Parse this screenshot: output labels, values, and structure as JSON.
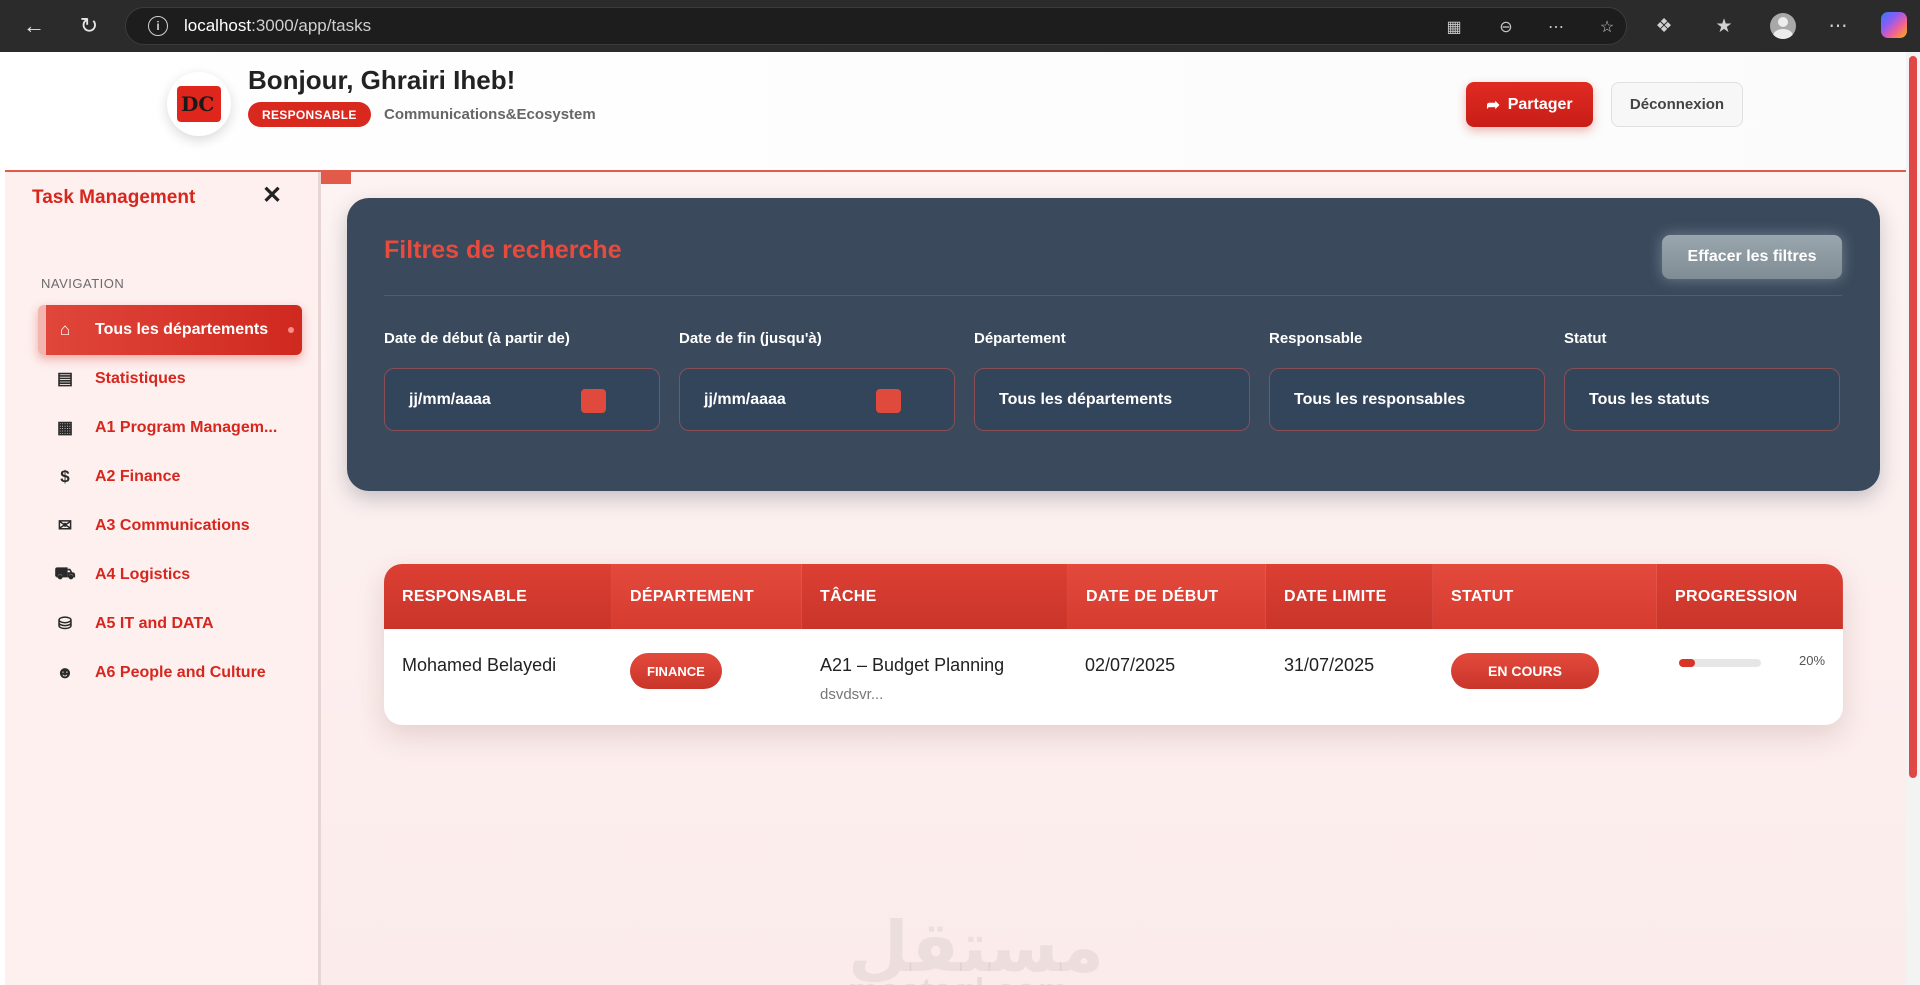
{
  "browser": {
    "url_host": "localhost",
    "url_rest": ":3000/app/tasks"
  },
  "header": {
    "greeting": "Bonjour, Ghrairi Iheb!",
    "role": "RESPONSABLE",
    "department": "Communications&Ecosystem",
    "share_label": "Partager",
    "logout_label": "Déconnexion"
  },
  "sidebar": {
    "title": "Task Management",
    "section": "NAVIGATION",
    "items": [
      {
        "label": "Tous les départements",
        "icon": "home-icon",
        "active": true
      },
      {
        "label": "Statistiques",
        "icon": "bar-chart-icon"
      },
      {
        "label": "A1 Program Managem...",
        "icon": "building-icon"
      },
      {
        "label": "A2 Finance",
        "icon": "dollar-icon"
      },
      {
        "label": "A3 Communications",
        "icon": "comments-icon"
      },
      {
        "label": "A4 Logistics",
        "icon": "truck-icon"
      },
      {
        "label": "A5 IT and DATA",
        "icon": "database-icon"
      },
      {
        "label": "A6 People and Culture",
        "icon": "users-icon"
      }
    ]
  },
  "filters": {
    "title": "Filtres de recherche",
    "clear_label": "Effacer les filtres",
    "fields": [
      {
        "label": "Date de début (à partir de)",
        "value": "jj/mm/aaaa"
      },
      {
        "label": "Date de fin (jusqu'à)",
        "value": "jj/mm/aaaa"
      },
      {
        "label": "Département",
        "value": "Tous les départements"
      },
      {
        "label": "Responsable",
        "value": "Tous les responsables"
      },
      {
        "label": "Statut",
        "value": "Tous les statuts"
      }
    ]
  },
  "table": {
    "columns": [
      "RESPONSABLE",
      "DÉPARTEMENT",
      "TÂCHE",
      "DATE DE DÉBUT",
      "DATE LIMITE",
      "STATUT",
      "PROGRESSION"
    ],
    "rows": [
      {
        "responsable": "Mohamed Belayedi",
        "departement": "FINANCE",
        "tache": "A21 – Budget Planning",
        "description": "dsvdsvr...",
        "date_debut": "02/07/2025",
        "date_limite": "31/07/2025",
        "statut": "EN COURS",
        "progression": 20,
        "progression_label": "20%"
      }
    ]
  },
  "watermark": {
    "arabic": "مستقل",
    "latin": "mostaql.com"
  },
  "colors": {
    "accent": "#d7261e",
    "filter_panel": "#3a4a5c",
    "sidebar_bg": "#fdf0ef"
  }
}
